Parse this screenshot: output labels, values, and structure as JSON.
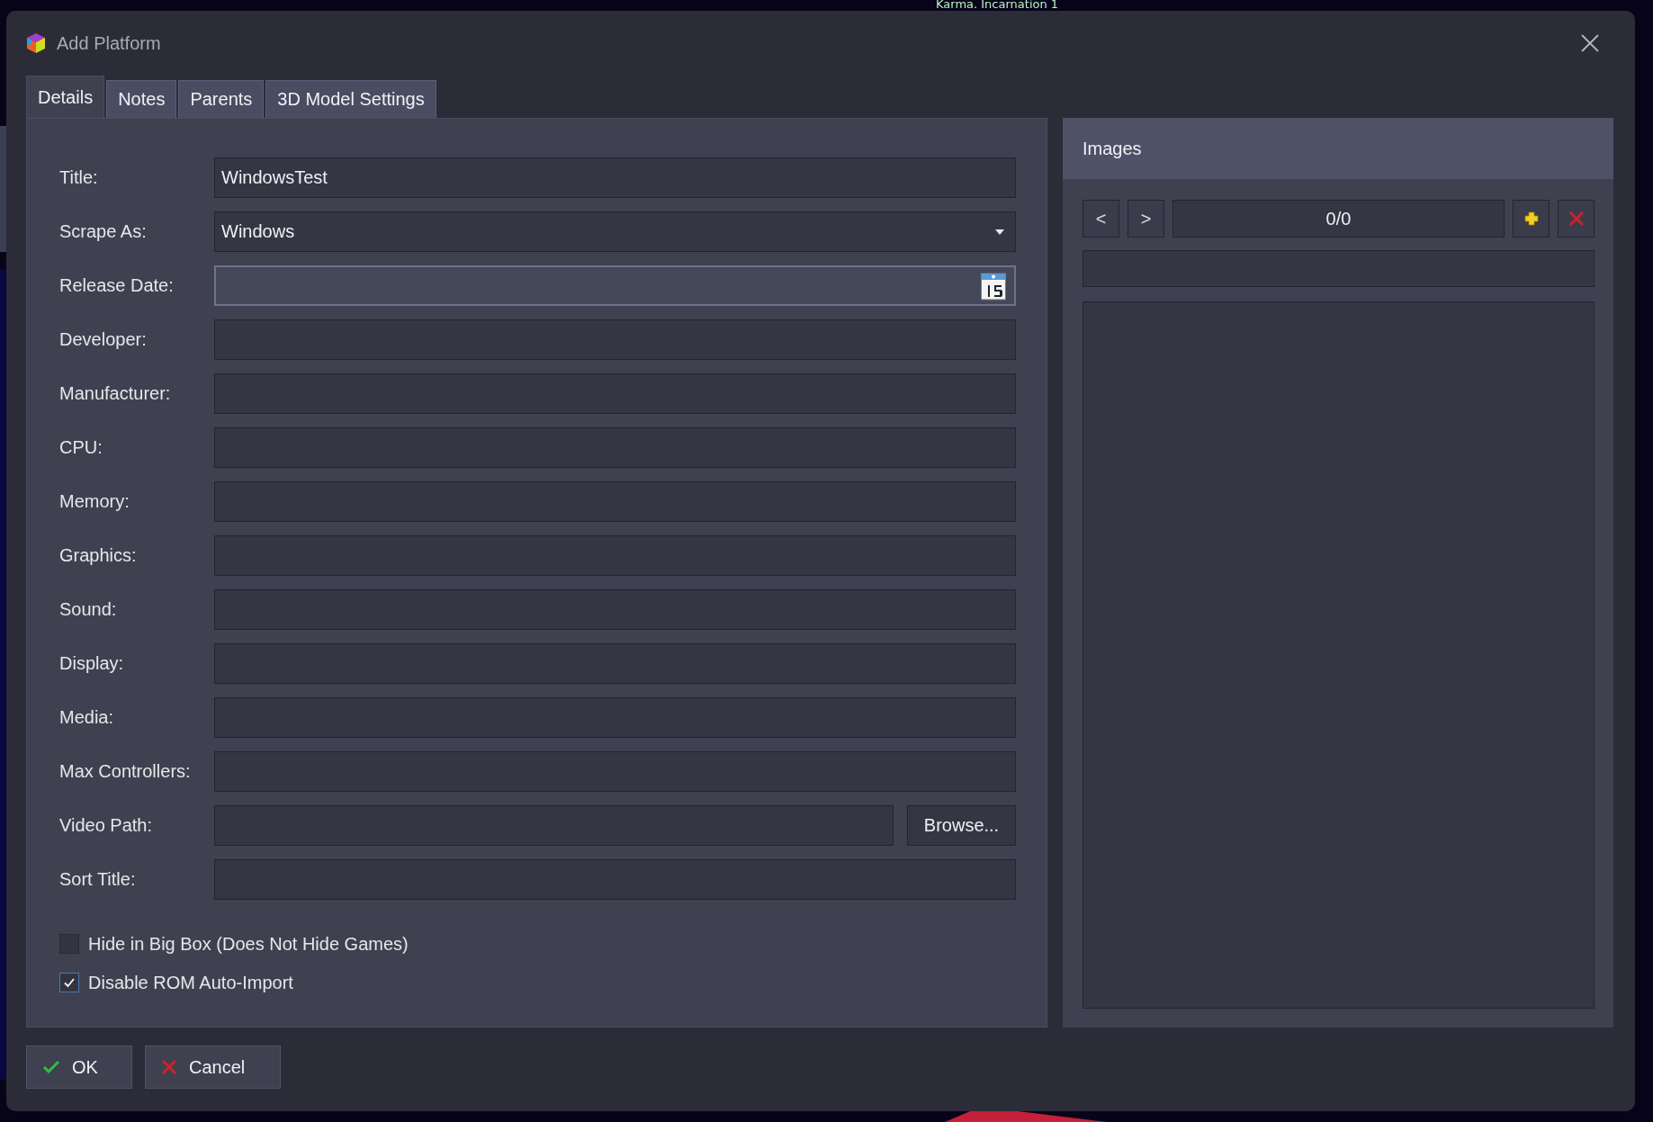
{
  "background_text": "Karma. Incarnation 1",
  "window": {
    "title": "Add Platform"
  },
  "tabs": [
    {
      "label": "Details",
      "selected": true
    },
    {
      "label": "Notes",
      "selected": false
    },
    {
      "label": "Parents",
      "selected": false
    },
    {
      "label": "3D Model Settings",
      "selected": false
    }
  ],
  "fields": [
    {
      "label": "Title:",
      "kind": "text",
      "value": "WindowsTest",
      "focused": false
    },
    {
      "label": "Scrape As:",
      "kind": "dropdown",
      "value": "Windows",
      "focused": false
    },
    {
      "label": "Release Date:",
      "kind": "date",
      "focused": true
    },
    {
      "label": "Developer:",
      "kind": "text",
      "focused": false
    },
    {
      "label": "Manufacturer:",
      "kind": "text",
      "focused": false
    },
    {
      "label": "CPU:",
      "kind": "text",
      "focused": false
    },
    {
      "label": "Memory:",
      "kind": "text",
      "focused": false
    },
    {
      "label": "Graphics:",
      "kind": "text",
      "focused": false
    },
    {
      "label": "Sound:",
      "kind": "text",
      "focused": false
    },
    {
      "label": "Display:",
      "kind": "text",
      "focused": false
    },
    {
      "label": "Media:",
      "kind": "text",
      "focused": false
    },
    {
      "label": "Max Controllers:",
      "kind": "text",
      "focused": false
    },
    {
      "label": "Video Path:",
      "kind": "path",
      "button": "Browse...",
      "focused": false
    },
    {
      "label": "Sort Title:",
      "kind": "text",
      "focused": false
    }
  ],
  "checkboxes": [
    {
      "label": "Hide in Big Box (Does Not Hide Games)",
      "checked": false
    },
    {
      "label": "Disable ROM Auto-Import",
      "checked": true
    }
  ],
  "images": {
    "title": "Images",
    "prev": "<",
    "next": ">",
    "counter": "0/0"
  },
  "buttons": [
    {
      "kind": "ok",
      "label": "OK"
    },
    {
      "kind": "cancel",
      "label": "Cancel"
    }
  ]
}
